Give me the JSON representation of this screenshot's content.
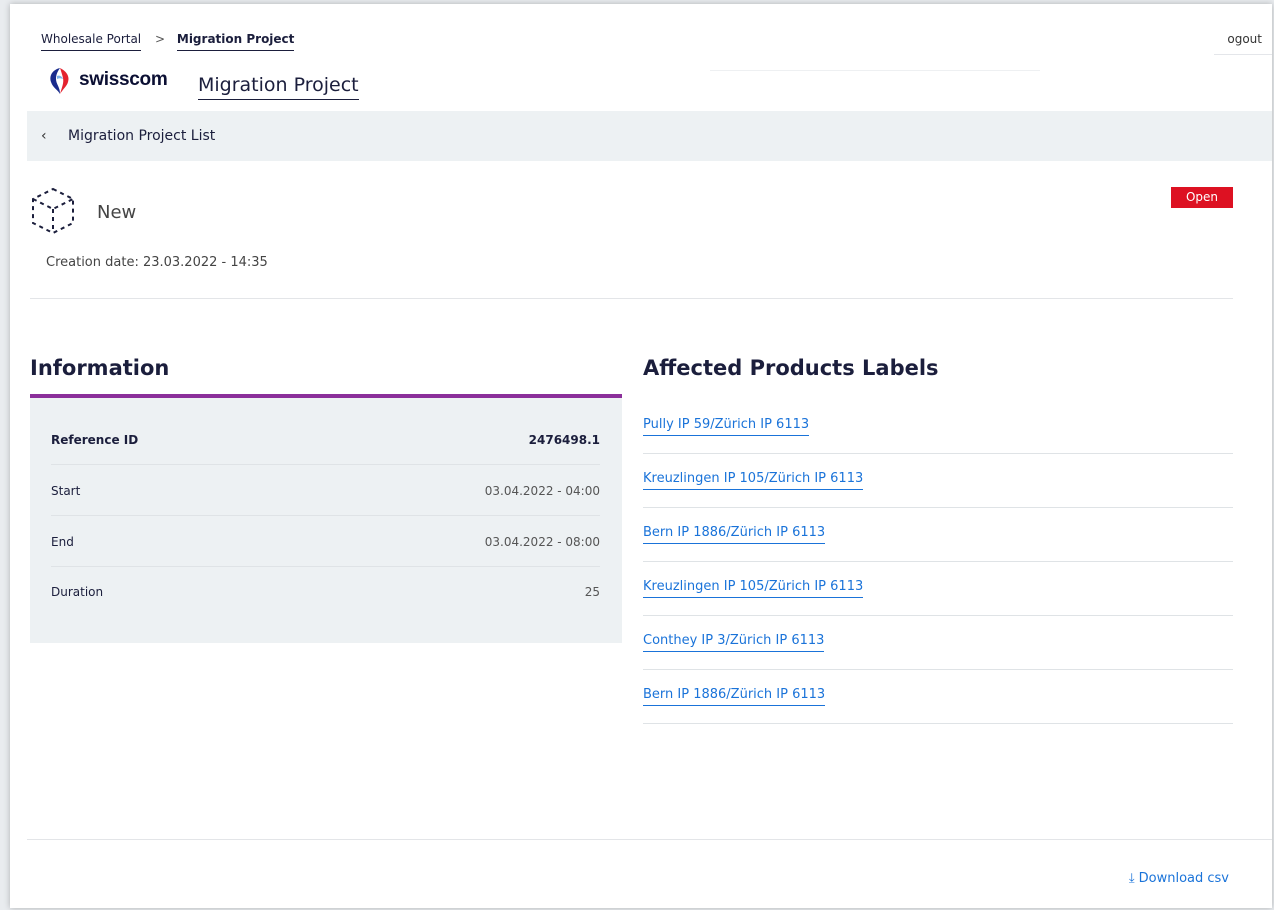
{
  "breadcrumb": {
    "items": [
      "Wholesale Portal",
      "Migration Project"
    ],
    "separator": ">"
  },
  "header": {
    "logout_label": "ogout",
    "brand_name": "swisscom",
    "page_title": "Migration Project"
  },
  "back_nav": {
    "icon": "chevron-left-icon",
    "label": "Migration Project List"
  },
  "project": {
    "icon": "cube-icon",
    "name": "New",
    "status": "Open",
    "status_color": "#dd1122",
    "creation_date": "Creation date: 23.03.2022 - 14:35"
  },
  "information": {
    "title": "Information",
    "accent_color": "#8b2f9a",
    "rows": [
      {
        "key": "Reference ID",
        "value": "2476498.1"
      },
      {
        "key": "Start",
        "value": "03.04.2022 - 04:00"
      },
      {
        "key": "End",
        "value": "03.04.2022 - 08:00"
      },
      {
        "key": "Duration",
        "value": "25"
      }
    ]
  },
  "affected_products": {
    "title": "Affected Products Labels",
    "items": [
      "Pully IP 59/Zürich IP 6113",
      "Kreuzlingen IP 105/Zürich IP 6113",
      "Bern IP 1886/Zürich IP 6113",
      "Kreuzlingen IP 105/Zürich IP 6113",
      "Conthey IP 3/Zürich IP 6113",
      "Bern IP 1886/Zürich IP 6113"
    ]
  },
  "footer": {
    "download_icon": "download-icon",
    "download_label": "Download csv"
  }
}
